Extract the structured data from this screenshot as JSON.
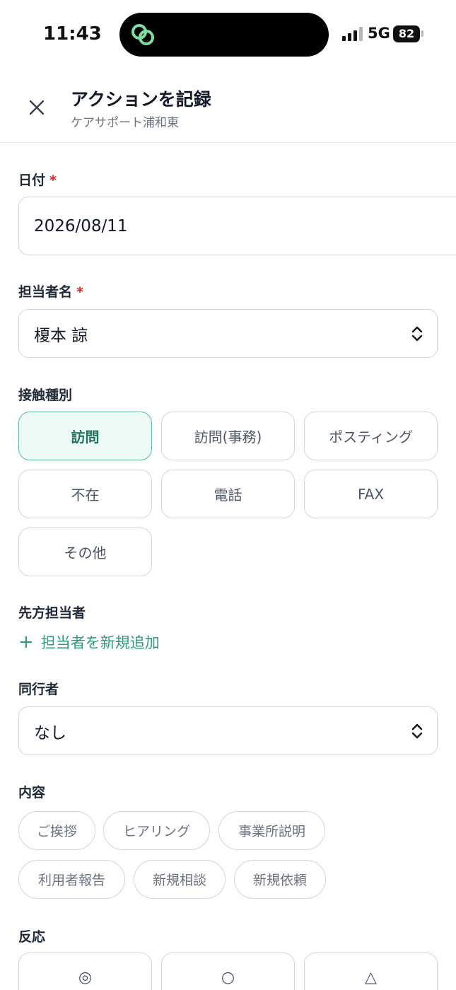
{
  "status_bar": {
    "time": "11:43",
    "network": "5G",
    "battery": "82"
  },
  "header": {
    "title": "アクションを記録",
    "subtitle": "ケアサポート浦和東",
    "close_icon": "close-icon"
  },
  "form": {
    "date": {
      "label": "日付",
      "required_mark": "*",
      "value": "2026/08/11"
    },
    "assignee": {
      "label": "担当者名",
      "required_mark": "*",
      "value": "榎本 諒"
    },
    "contact_type": {
      "label": "接触種別",
      "options": [
        "訪問",
        "訪問(事務)",
        "ポスティング",
        "不在",
        "電話",
        "FAX",
        "その他"
      ],
      "selected": "訪問"
    },
    "counterpart": {
      "label": "先方担当者",
      "add_link": "担当者を新規追加",
      "add_icon": "+"
    },
    "companion": {
      "label": "同行者",
      "value": "なし"
    },
    "content": {
      "label": "内容",
      "tags": [
        "ご挨拶",
        "ヒアリング",
        "事業所説明",
        "利用者報告",
        "新規相談",
        "新規依頼"
      ]
    },
    "reaction": {
      "label": "反応",
      "options": [
        "◎",
        "○",
        "△"
      ]
    }
  },
  "colors": {
    "accent": "#2f9a80",
    "selected_bg": "#eefaf6",
    "selected_border": "#5eb8a2",
    "required": "#dc2626"
  }
}
